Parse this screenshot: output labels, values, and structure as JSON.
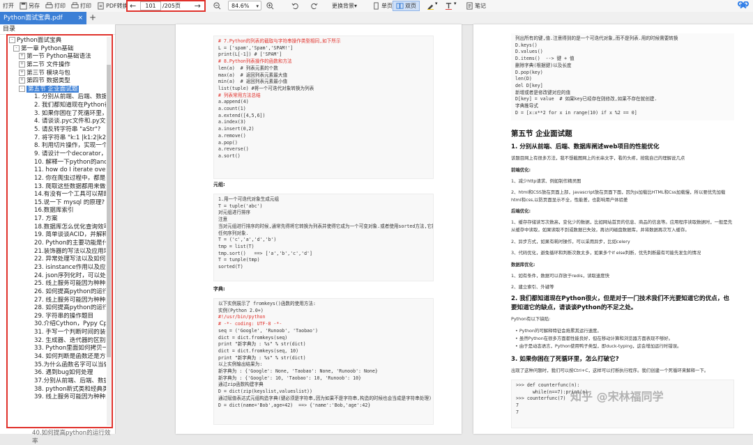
{
  "toolbar": {
    "open": "打开",
    "saveas": "另存",
    "print": "打印",
    "print2": "打印",
    "pdfconv": "PDF转换",
    "page_current": "101",
    "page_total": "/205页",
    "zoom": "84.6%",
    "bg": "更换背景",
    "single": "单页",
    "double": "双页",
    "notes": "笔记"
  },
  "tabs": {
    "file": "Python面试宝典.pdf",
    "close": "×",
    "add": "+"
  },
  "sidebar": {
    "title": "目录",
    "items": [
      {
        "text": "Python面试宝典",
        "level": 0,
        "pm": "-"
      },
      {
        "text": "第一章 Python基础",
        "level": 1,
        "pm": "-"
      },
      {
        "text": "第一节 Python基础语法",
        "level": 2,
        "pm": "+"
      },
      {
        "text": "第二节 文件操作",
        "level": 2,
        "pm": "+"
      },
      {
        "text": "第三节 模块与包",
        "level": 2,
        "pm": "+"
      },
      {
        "text": "第四节 数据类型",
        "level": 2,
        "pm": "+"
      },
      {
        "text": "第五节 企业面试题",
        "level": 2,
        "pm": "-",
        "sel": true
      },
      {
        "text": "1. 分别从前端、后端、数据库阐",
        "level": 3
      },
      {
        "text": "2. 我们都知道现在Python很火",
        "level": 3
      },
      {
        "text": "3. 如果你困在了死循环里，怎么",
        "level": 3
      },
      {
        "text": "4. 请谈谈.pyc文件和.py文件的",
        "level": 3
      },
      {
        "text": "5. 请反转字符串 \"aStr\"?",
        "level": 3
      },
      {
        "text": "7. 将字符串 \"k:1 |k1:2|k2:3|k3",
        "level": 3
      },
      {
        "text": "8. 利用切片操作，实现一个trim",
        "level": 3
      },
      {
        "text": "9. 请设计一个decorator，它可",
        "level": 3
      },
      {
        "text": "10. 解释一下python的and-or",
        "level": 3
      },
      {
        "text": "11. how do I iterate over a s",
        "level": 3
      },
      {
        "text": "12. 你在爬虫过程中，都是怎么",
        "level": 3
      },
      {
        "text": "13. 爬取这些数据都用来做什么",
        "level": 3
      },
      {
        "text": "14.有没有一个工具可以帮助查",
        "level": 3
      },
      {
        "text": "15.说一下 mysql 的原理?",
        "level": 3
      },
      {
        "text": "16.数据库索引",
        "level": 3
      },
      {
        "text": "17. 方案",
        "level": 3
      },
      {
        "text": "18.数据库怎么优化查询效率?",
        "level": 3
      },
      {
        "text": "19. 简单谈谈ACID，并解释每一",
        "level": 3
      },
      {
        "text": "20. Python的主要功能是什么?",
        "level": 3
      },
      {
        "text": "21.装饰器的写法以及应用场景",
        "level": 3
      },
      {
        "text": "22. 异常处理写法以及如何主动",
        "level": 3
      },
      {
        "text": "23. isinstance作用以及应用场",
        "level": 3
      },
      {
        "text": "24. json序列化时，可以处理的",
        "level": 3
      },
      {
        "text": "25. 线上服务可能因为种种原因",
        "level": 3
      },
      {
        "text": "26. 如何提高python的运行效率",
        "level": 3
      },
      {
        "text": "27. 线上服务可能因为种种原因",
        "level": 3
      },
      {
        "text": "28. 如何提高python的运行效率",
        "level": 3
      },
      {
        "text": "29. 字符串的操作题目",
        "level": 3
      },
      {
        "text": "30.介绍Cython，Pypy Cpytho",
        "level": 3
      },
      {
        "text": "31. 手写一个判断时间的装饰器",
        "level": 3
      },
      {
        "text": "32. 生成器、迭代器的区别?",
        "level": 3
      },
      {
        "text": "33. Python里面如何拷贝一个对",
        "level": 3
      },
      {
        "text": "34. 如何判断是函数还是方法?",
        "level": 3
      },
      {
        "text": "35.为什么函数名字可以当做参数",
        "level": 3
      },
      {
        "text": "36. 遇到bug如何处理",
        "level": 3
      },
      {
        "text": "37.分别从前端、后端、数据库阐",
        "level": 3
      },
      {
        "text": "38. python新式类和经典类的区",
        "level": 3
      },
      {
        "text": "39. 线上服务可能因为种种原因",
        "level": 3
      }
    ],
    "tail": "40.如何提高python的运行效率"
  },
  "page1": {
    "code1": [
      {
        "t": "# 7.Python的列表的截取与字符串操作类型相同,如下所示",
        "c": true
      },
      {
        "t": "L = ['spam','Spam','SPAM!']"
      },
      {
        "t": "print(L[-1]) # ['SPAM']",
        "c2": true
      },
      {
        "t": ""
      },
      {
        "t": "# 8.Python列表操作的函数和方法",
        "c": true
      },
      {
        "t": "len(a)  # 列表元素的个数"
      },
      {
        "t": "max(a)  # 返回列表元素最大值"
      },
      {
        "t": "min(a)  # 返回列表元素最小值"
      },
      {
        "t": "list(tuple) #将一个可迭代对象转换为列表"
      },
      {
        "t": ""
      },
      {
        "t": "# 列表常用方法总结",
        "c": true
      },
      {
        "t": "a.append(4)"
      },
      {
        "t": "a.count(1)"
      },
      {
        "t": "a.extend([4,5,6])"
      },
      {
        "t": "a.index(3)"
      },
      {
        "t": "a.insert(0,2)"
      },
      {
        "t": "a.remove()"
      },
      {
        "t": "a.pop()"
      },
      {
        "t": "a.reverse()"
      },
      {
        "t": "a.sort()"
      }
    ],
    "label_tuple": "元组:",
    "code2": [
      {
        "t": "1.用一个可迭代对象生成元组"
      },
      {
        "t": "T = tuple('abc')"
      },
      {
        "t": "对元组进行排序"
      },
      {
        "t": "注意"
      },
      {
        "t": "当对元组进行排序的时候,通常先得将它转换为列表并使得它成为一个可变对象.或者使用sorted方法,它接收"
      },
      {
        "t": "任何序列对象."
      },
      {
        "t": ""
      },
      {
        "t": "T = ('c','a','d','b')"
      },
      {
        "t": "tmp = list(T)"
      },
      {
        "t": "tmp.sort()   ==> ['a','b','c','d']"
      },
      {
        "t": "T = tunple(tmp)"
      },
      {
        "t": "sorted(T)"
      }
    ],
    "label_dict": "字典:",
    "code3": [
      {
        "t": "以下实例展示了 fromkeys()函数的使用方法:"
      },
      {
        "t": ""
      },
      {
        "t": "实例(Python 2.0+)"
      },
      {
        "t": "#!/usr/bin/python",
        "c": true
      },
      {
        "t": "# -*- coding: UTF-8 -*-",
        "c": true
      },
      {
        "t": "seq = ('Google', 'Runoob', 'Taobao')"
      },
      {
        "t": "dict = dict.fromkeys(seq)"
      },
      {
        "t": "print \"新字典为 : %s\" % str(dict)"
      },
      {
        "t": "dict = dict.fromkeys(seq, 10)"
      },
      {
        "t": "print \"新字典为 : %s\" % str(dict)"
      },
      {
        "t": "以上实例输出结果为:"
      },
      {
        "t": ""
      },
      {
        "t": "新字典为 : {'Google': None, 'Taobao': None, 'Runoob': None}"
      },
      {
        "t": "新字典为 : {'Google': 10, 'Taobao': 10, 'Runoob': 10}"
      },
      {
        "t": "通过zip函数构建字典"
      },
      {
        "t": "D = dict(zip(keyslist,valueslist))"
      },
      {
        "t": "通过赋值表达式元组构造字典(键必须是字符串,因为如果不是字符串,构造的时候也会当成是字符串处理)"
      },
      {
        "t": "D = dict(name='Bob',age=42)  ==> {'name':'Bob,'age':42}"
      }
    ]
  },
  "page2": {
    "code1": [
      {
        "t": "列出所有的键,值.注意得到的是一个可迭代对象,而不是列表.用的时候需要转换"
      },
      {
        "t": "D.keys()"
      },
      {
        "t": "D.values()"
      },
      {
        "t": "D.items()  --> 键 + 值"
      },
      {
        "t": "删除字典(根据键)以及长度"
      },
      {
        "t": "D.pop(key)"
      },
      {
        "t": "len(D)"
      },
      {
        "t": "del D[key]"
      },
      {
        "t": "新增或者是修改键对应的值"
      },
      {
        "t": "D[key] = value  # 如果key已经存在则修改,如果不存在就创建."
      },
      {
        "t": "字典推导式"
      },
      {
        "t": "D = [x:x**2 for x in range(10) if x %2 == 0]"
      }
    ],
    "h_section": "第五节 企业面试题",
    "q1": "1. 分别从前端、后端、数据库阐述web项目的性能优化",
    "q1_intro": "该题目网上有很多方法，我不想截图网上的长串文字，看的头疼，按我自己的理解说几点",
    "front_title": "前端优化:",
    "front1": "1、减少http请求、例如制作精灵图",
    "front2": "2、html和CSS放在页面上部，javascript放在页面下面，因为js加载比HTML和Css加载慢，所以要优先加载html和css,以防页面显示不全，性能差，也影响用户体验差",
    "back_title": "后端优化:",
    "back1": "1、缓存存储读写次数高，变化少的数据，比如网站首页的信息、商品的信息等。应用程序读取数据时，一般是先从缓存中读取，如果读取不到或数据已失效，再访问磁盘数据库，并将数据再次写入缓存。",
    "back2": "2、异步方式，如果有耗时操作，可以采用异步，比如celery",
    "back3": "3、代码优化，避免循环和判断次数太多，如果多个if else判断，优先判断最有可能先发生的情况",
    "db_title": "数据库优化:",
    "db1": "1、如有条件，数据可以存放于redis，读取速度快",
    "db2": "2、建立索引、外键等",
    "q2": "2. 我们都知道现在Python很火，但是对于一门技术我们不光要知道它的优点，也要知道它的缺点，请谈谈Python的不足之处。",
    "q2_intro": "Python有以下缺陷:",
    "b1": "Python的可解释特征会拖累其运行速度。",
    "b2": "虽然Python在很多方面都性能良好，但在移动计算和浏览器方面表现不够好。",
    "b3": "由于是动态语言，Python使用鸭子类型，即duck-typing，这会增加运行时错误。",
    "q3": "3. 如果你困在了死循环里，怎么打破它?",
    "q3_intro": "出现了这种问题时，我们可以按Ctrl+C，这样可以打断执行程序。我们创建一个死循环来解释一下。",
    "code2": [
      {
        "t": ">>> def counterfunc(n):"
      },
      {
        "t": "      while(n==7):print(n)"
      },
      {
        "t": ">>> counterfunc(7)"
      },
      {
        "t": "7"
      },
      {
        "t": ""
      },
      {
        "t": "7"
      }
    ],
    "watermark": "知乎 @宋林福同学"
  }
}
